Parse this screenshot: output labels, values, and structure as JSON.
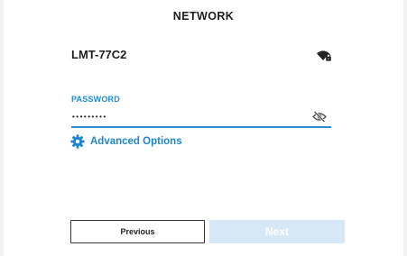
{
  "header": {
    "title": "NETWORK"
  },
  "network": {
    "ssid": "LMT-77C2",
    "signal_icon": "wifi-locked-icon"
  },
  "password": {
    "label": "PASSWORD",
    "value": "•••••••••",
    "visibility_icon": "eye-off-icon"
  },
  "advanced": {
    "label": "Advanced Options",
    "icon": "gear-icon"
  },
  "buttons": {
    "previous_label": "Previous",
    "next_label": "Next",
    "next_enabled": false
  },
  "colors": {
    "accent": "#1a86cf",
    "next_disabled_bg": "#d6e8f6"
  }
}
